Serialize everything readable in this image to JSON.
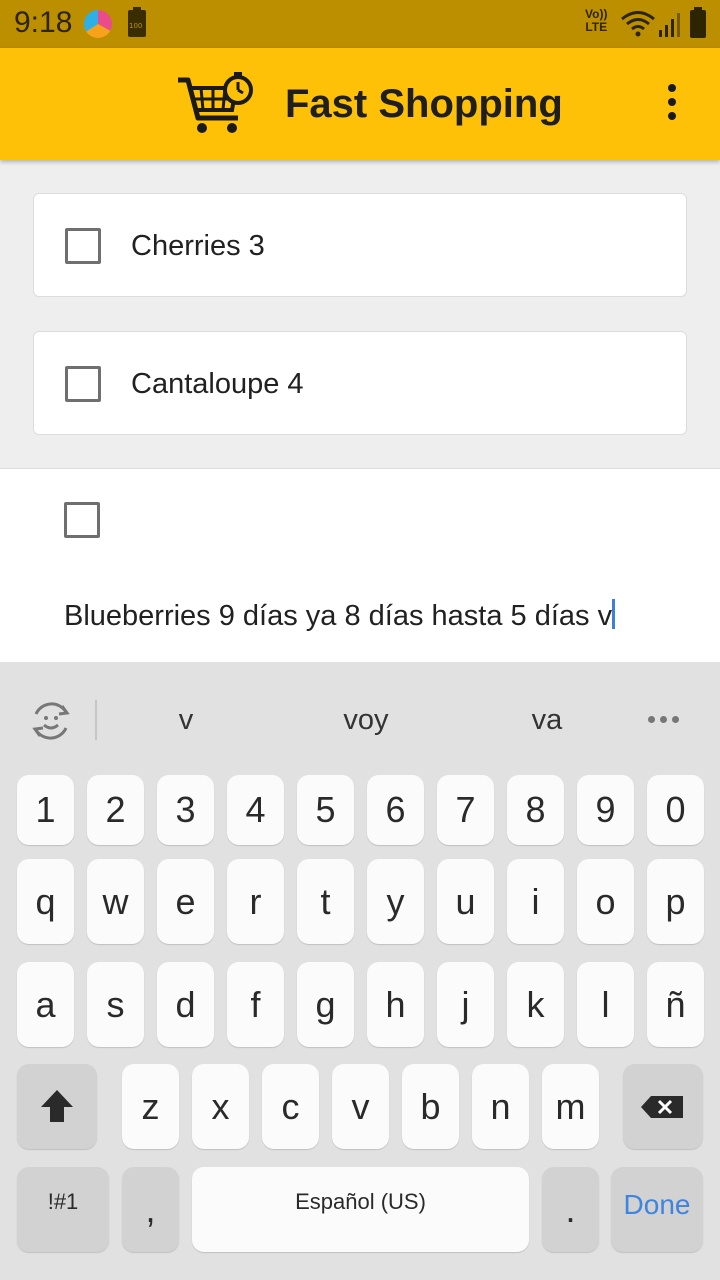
{
  "status_bar": {
    "time": "9:18",
    "battery_small_label": "100",
    "volte_line1": "Vo))",
    "volte_line2": "LTE"
  },
  "app_bar": {
    "title": "Fast Shopping",
    "logo_icon": "shopping-cart-timer-icon",
    "menu_icon": "more-vert-icon",
    "color": "#ffc107"
  },
  "items": [
    {
      "label": "Cherries 3",
      "checked": false
    },
    {
      "label": "Cantaloupe 4",
      "checked": false
    }
  ],
  "editing_item": {
    "checked": false,
    "text": "Blueberries 9 días ya  8 días hasta  5 días v"
  },
  "keyboard": {
    "suggestions": [
      "v",
      "voy",
      "va"
    ],
    "row_numbers": [
      "1",
      "2",
      "3",
      "4",
      "5",
      "6",
      "7",
      "8",
      "9",
      "0"
    ],
    "row_1": [
      "q",
      "w",
      "e",
      "r",
      "t",
      "y",
      "u",
      "i",
      "o",
      "p"
    ],
    "row_2": [
      "a",
      "s",
      "d",
      "f",
      "g",
      "h",
      "j",
      "k",
      "l",
      "ñ"
    ],
    "row_3": [
      "z",
      "x",
      "c",
      "v",
      "b",
      "n",
      "m"
    ],
    "symbols_label": "!#1",
    "comma_label": ",",
    "space_label": "Español (US)",
    "period_label": ".",
    "done_label": "Done",
    "accent_color": "#3f85de"
  }
}
